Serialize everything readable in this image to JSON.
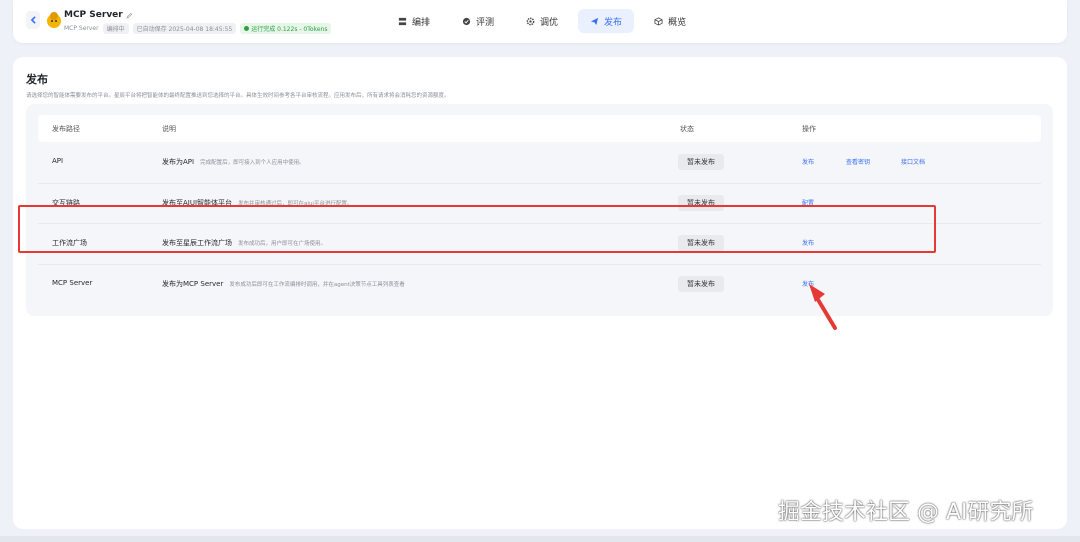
{
  "header": {
    "app_title": "MCP Server",
    "meta": {
      "name": "MCP Server",
      "state": "编排中",
      "autosave": "已自动保存 2025-04-08 18:45:55",
      "run_status": "运行完成 0.122s - 0Tokens"
    },
    "nav": [
      {
        "label": "编排",
        "icon": "layout-icon"
      },
      {
        "label": "评测",
        "icon": "evaluate-icon"
      },
      {
        "label": "调优",
        "icon": "gear-icon"
      },
      {
        "label": "发布",
        "icon": "send-icon",
        "active": true
      },
      {
        "label": "概览",
        "icon": "cube-icon"
      }
    ]
  },
  "panel": {
    "title": "发布",
    "desc": "请选择您的智能体需要发布的平台。星辰平台将把智能体的最终配置推送到您选择的平台。具体生效时间参考各平台审核流程。应用发布后，所有请求将会消耗您的资源额度。",
    "columns": [
      "发布路径",
      "说明",
      "状态",
      "操作"
    ],
    "rows": [
      {
        "name": "API",
        "title": "发布为API",
        "sub": "完成配置后，即可接入到个人应用中使用。",
        "status": "暂未发布",
        "ops": [
          "发布",
          "查看密钥",
          "接口文档"
        ]
      },
      {
        "name": "交互链路",
        "title": "发布至AIUI智能体平台",
        "sub": "发布并审核通过后，即可在aiui平台进行配置。",
        "status": "暂未发布",
        "ops": [
          "配置"
        ]
      },
      {
        "name": "工作流广场",
        "title": "发布至星辰工作流广场",
        "sub": "发布成功后，用户即可在广场使用。",
        "status": "暂未发布",
        "ops": [
          "发布"
        ]
      },
      {
        "name": "MCP Server",
        "title": "发布为MCP Server",
        "sub": "发布成功后即可在工作流编排时调用，并在agent决策节点工具列表查看",
        "status": "暂未发布",
        "ops": [
          "发布"
        ]
      }
    ]
  },
  "colors": {
    "accent": "#3a6ff5",
    "highlight": "#e53935",
    "success": "#2ea043"
  },
  "watermark": "掘金技术社区 @ AI研究所"
}
